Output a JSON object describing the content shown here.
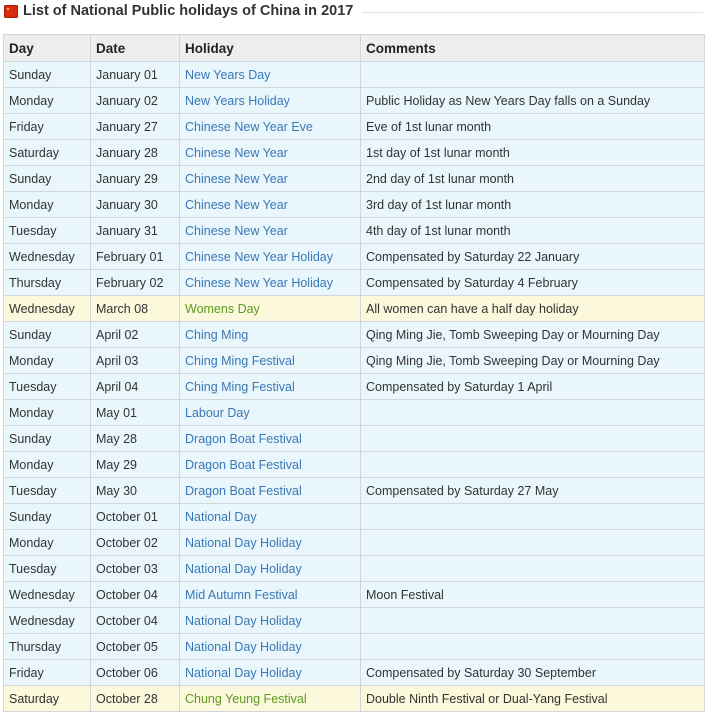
{
  "header": {
    "flag_icon": "china-flag-icon",
    "title": "List of National Public holidays of China in 2017"
  },
  "table": {
    "columns": [
      "Day",
      "Date",
      "Holiday",
      "Comments"
    ],
    "rows": [
      {
        "day": "Sunday",
        "date": "January 01",
        "holiday": "New Years Day",
        "comments": "",
        "highlight": false
      },
      {
        "day": "Monday",
        "date": "January 02",
        "holiday": "New Years Holiday",
        "comments": "Public Holiday as New Years Day falls on a Sunday",
        "highlight": false
      },
      {
        "day": "Friday",
        "date": "January 27",
        "holiday": "Chinese New Year Eve",
        "comments": "Eve of 1st lunar month",
        "highlight": false
      },
      {
        "day": "Saturday",
        "date": "January 28",
        "holiday": "Chinese New Year",
        "comments": "1st day of 1st lunar month",
        "highlight": false
      },
      {
        "day": "Sunday",
        "date": "January 29",
        "holiday": "Chinese New Year",
        "comments": "2nd day of 1st lunar month",
        "highlight": false
      },
      {
        "day": "Monday",
        "date": "January 30",
        "holiday": "Chinese New Year",
        "comments": "3rd day of 1st lunar month",
        "highlight": false
      },
      {
        "day": "Tuesday",
        "date": "January 31",
        "holiday": "Chinese New Year",
        "comments": "4th day of 1st lunar month",
        "highlight": false
      },
      {
        "day": "Wednesday",
        "date": "February 01",
        "holiday": "Chinese New Year Holiday",
        "comments": "Compensated by Saturday 22 January",
        "highlight": false
      },
      {
        "day": "Thursday",
        "date": "February 02",
        "holiday": "Chinese New Year Holiday",
        "comments": "Compensated by Saturday 4 February",
        "highlight": false
      },
      {
        "day": "Wednesday",
        "date": "March 08",
        "holiday": "Womens Day",
        "comments": "All women can have a half day holiday",
        "highlight": true
      },
      {
        "day": "Sunday",
        "date": "April 02",
        "holiday": "Ching Ming",
        "comments": "Qing Ming Jie, Tomb Sweeping Day or Mourning Day",
        "highlight": false
      },
      {
        "day": "Monday",
        "date": "April 03",
        "holiday": "Ching Ming Festival",
        "comments": "Qing Ming Jie, Tomb Sweeping Day or Mourning Day",
        "highlight": false
      },
      {
        "day": "Tuesday",
        "date": "April 04",
        "holiday": "Ching Ming Festival",
        "comments": "Compensated by Saturday 1 April",
        "highlight": false
      },
      {
        "day": "Monday",
        "date": "May 01",
        "holiday": "Labour Day",
        "comments": "",
        "highlight": false
      },
      {
        "day": "Sunday",
        "date": "May 28",
        "holiday": "Dragon Boat Festival",
        "comments": "",
        "highlight": false
      },
      {
        "day": "Monday",
        "date": "May 29",
        "holiday": "Dragon Boat Festival",
        "comments": "",
        "highlight": false
      },
      {
        "day": "Tuesday",
        "date": "May 30",
        "holiday": "Dragon Boat Festival",
        "comments": "Compensated by Saturday 27 May",
        "highlight": false
      },
      {
        "day": "Sunday",
        "date": "October 01",
        "holiday": "National Day",
        "comments": "",
        "highlight": false
      },
      {
        "day": "Monday",
        "date": "October 02",
        "holiday": "National Day Holiday",
        "comments": "",
        "highlight": false
      },
      {
        "day": "Tuesday",
        "date": "October 03",
        "holiday": "National Day Holiday",
        "comments": "",
        "highlight": false
      },
      {
        "day": "Wednesday",
        "date": "October 04",
        "holiday": "Mid Autumn Festival",
        "comments": "Moon Festival",
        "highlight": false
      },
      {
        "day": "Wednesday",
        "date": "October 04",
        "holiday": "National Day Holiday",
        "comments": "",
        "highlight": false
      },
      {
        "day": "Thursday",
        "date": "October 05",
        "holiday": "National Day Holiday",
        "comments": "",
        "highlight": false
      },
      {
        "day": "Friday",
        "date": "October 06",
        "holiday": "National Day Holiday",
        "comments": "Compensated by Saturday 30 September",
        "highlight": false
      },
      {
        "day": "Saturday",
        "date": "October 28",
        "holiday": "Chung Yeung Festival",
        "comments": "Double Ninth Festival or Dual-Yang Festival",
        "highlight": true
      }
    ]
  },
  "colors": {
    "row_bg": "#e9f6fc",
    "highlight_bg": "#fbf8dc",
    "holiday_link": "#3a78b6",
    "highlight_link": "#5e9b20",
    "header_bg": "#eeeeee",
    "border": "#d2d6da"
  }
}
